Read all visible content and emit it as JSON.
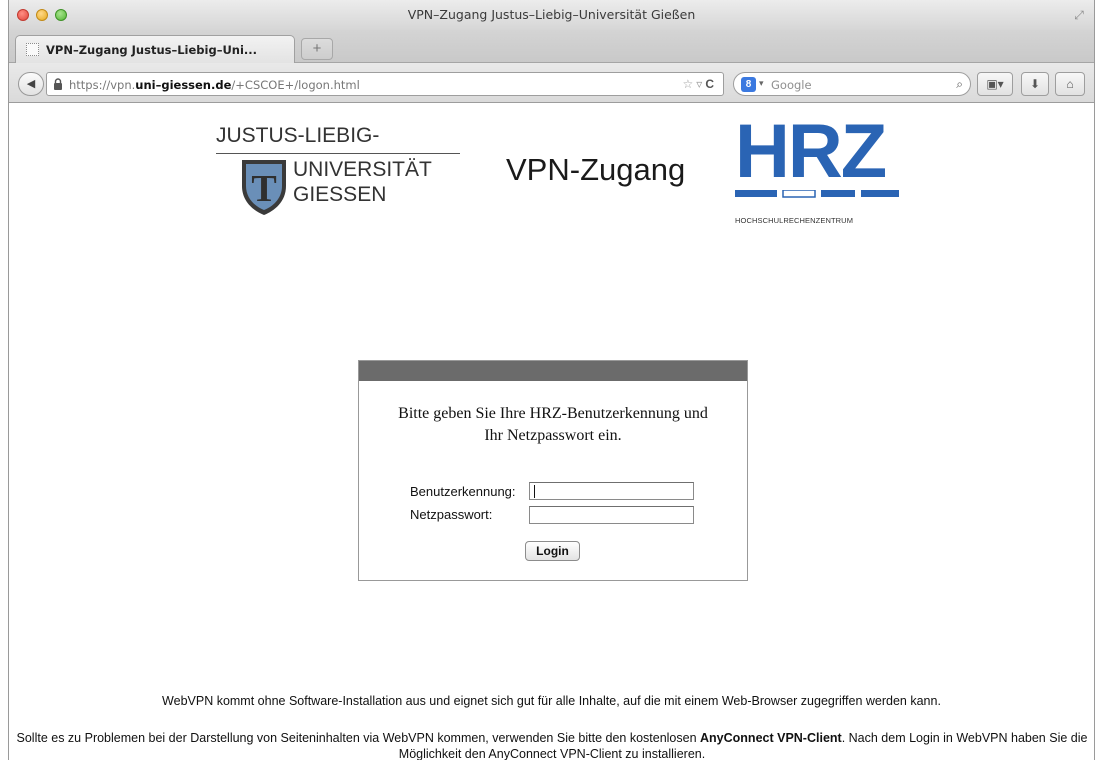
{
  "window": {
    "title": "VPN–Zugang Justus–Liebig–Universität Gießen"
  },
  "tabs": [
    {
      "label": "VPN–Zugang Justus–Liebig–Uni...",
      "active": true
    }
  ],
  "newtab_label": "+",
  "navbar": {
    "url_prefix": "https://vpn.",
    "url_domain": "uni–giessen.de",
    "url_path": "/+CSCOE+/logon.html",
    "search_engine_icon": "google-g-icon",
    "search_engine_glyph": "8",
    "search_placeholder": "Google"
  },
  "page": {
    "jlu_logo": {
      "line1": "JUSTUS-LIEBIG-",
      "line2": "UNIVERSITÄT",
      "line3": "GIESSEN",
      "crest_letter": "T"
    },
    "heading": "VPN-Zugang",
    "hrz_logo": {
      "letters": "HRZ",
      "subtitle": "HOCHSCHULRECHENZENTRUM",
      "color": "#2a64b4"
    },
    "login": {
      "intro_line1": "Bitte geben Sie Ihre HRZ-Benutzerkennung und",
      "intro_line2": "Ihr Netzpasswort ein.",
      "username_label": "Benutzerkennung:",
      "username_value": "",
      "password_label": "Netzpasswort:",
      "password_value": "",
      "button_label": "Login",
      "header_color": "#6b6b6b"
    },
    "info_line1": "WebVPN kommt ohne Software-Installation aus und eignet sich gut für alle Inhalte, auf die mit einem Web-Browser zugegriffen werden kann.",
    "info_line2_pre": "Sollte es zu Problemen bei der Darstellung von Seiteninhalten via WebVPN kommen, verwenden Sie bitte den kostenlosen ",
    "info_line2_bold": "AnyConnect VPN-Client",
    "info_line2_post": ". Nach dem Login in WebVPN haben Sie die Möglichkeit den AnyConnect VPN-Client zu installieren."
  }
}
